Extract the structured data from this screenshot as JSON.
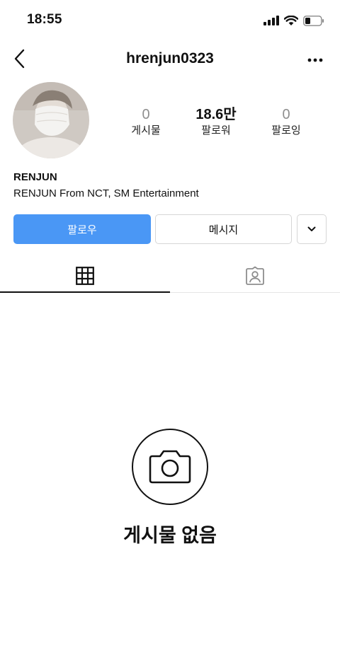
{
  "status_bar": {
    "time": "18:55"
  },
  "nav": {
    "username": "hrenjun0323"
  },
  "profile": {
    "stats": [
      {
        "value": "0",
        "label": "게시물"
      },
      {
        "value": "18.6만",
        "label": "팔로워"
      },
      {
        "value": "0",
        "label": "팔로잉"
      }
    ],
    "name": "RENJUN",
    "bio": "RENJUN From NCT, SM Entertainment"
  },
  "actions": {
    "follow_label": "팔로우",
    "message_label": "메시지"
  },
  "tabs": {
    "active": "grid",
    "items": [
      "grid",
      "tagged"
    ]
  },
  "empty_state": {
    "title": "게시물 없음"
  },
  "colors": {
    "accent": "#4a97f5",
    "text": "#111111",
    "muted": "#8e8e8e",
    "border": "#d6d6d6"
  }
}
